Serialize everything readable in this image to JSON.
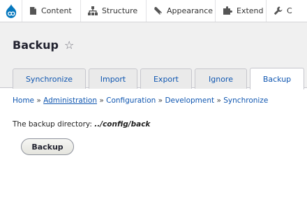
{
  "toolbar": {
    "items": [
      {
        "label": "Content",
        "icon": "page-icon"
      },
      {
        "label": "Structure",
        "icon": "sitemap-icon"
      },
      {
        "label": "Appearance",
        "icon": "paintbrush-icon"
      },
      {
        "label": "Extend",
        "icon": "puzzle-icon"
      },
      {
        "label": "C",
        "icon": "wrench-icon"
      }
    ],
    "logo_color": "#0678be"
  },
  "page": {
    "title": "Backup",
    "favorite_icon": "☆"
  },
  "tabs": [
    {
      "label": "Synchronize",
      "active": false
    },
    {
      "label": "Import",
      "active": false
    },
    {
      "label": "Export",
      "active": false
    },
    {
      "label": "Ignore",
      "active": false
    },
    {
      "label": "Backup",
      "active": true
    }
  ],
  "breadcrumb": {
    "items": [
      "Home",
      "Administration",
      "Configuration",
      "Development",
      "Synchronize"
    ],
    "separator": "»"
  },
  "content": {
    "dir_label": "The backup directory:",
    "dir_value": "../config/back",
    "backup_button": "Backup"
  }
}
